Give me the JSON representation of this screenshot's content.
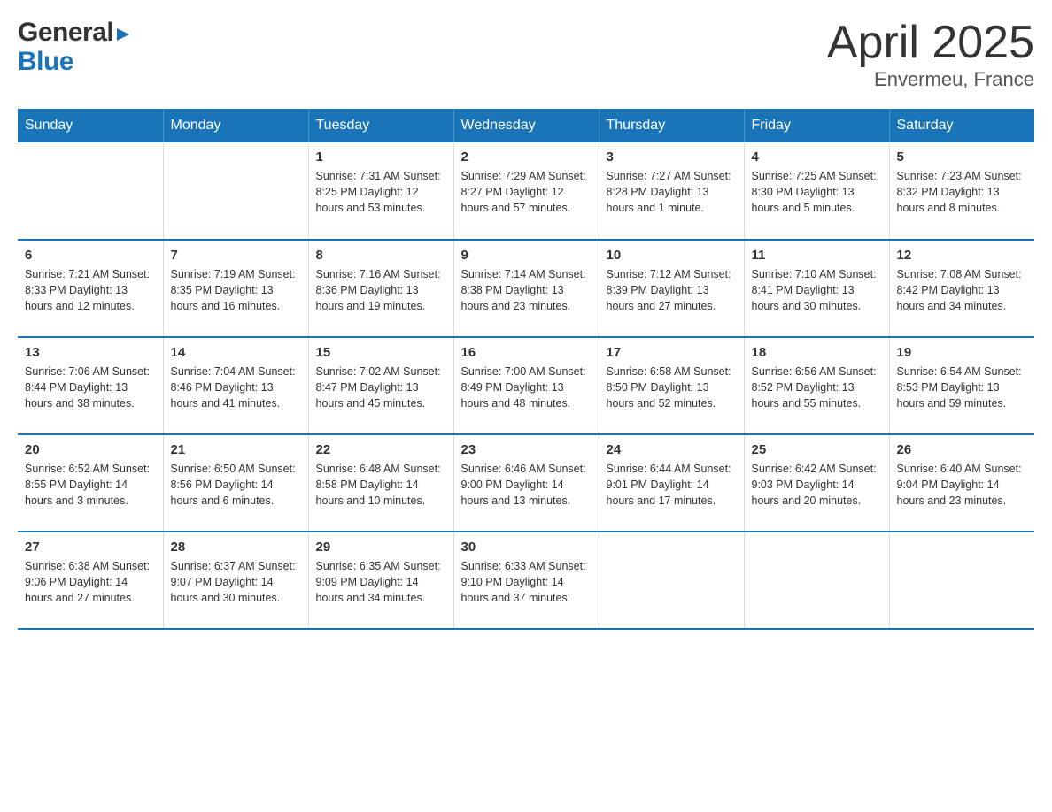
{
  "header": {
    "logo_general": "General",
    "logo_blue": "Blue",
    "title": "April 2025",
    "subtitle": "Envermeu, France"
  },
  "days_of_week": [
    "Sunday",
    "Monday",
    "Tuesday",
    "Wednesday",
    "Thursday",
    "Friday",
    "Saturday"
  ],
  "weeks": [
    [
      {
        "day": "",
        "info": ""
      },
      {
        "day": "",
        "info": ""
      },
      {
        "day": "1",
        "info": "Sunrise: 7:31 AM\nSunset: 8:25 PM\nDaylight: 12 hours\nand 53 minutes."
      },
      {
        "day": "2",
        "info": "Sunrise: 7:29 AM\nSunset: 8:27 PM\nDaylight: 12 hours\nand 57 minutes."
      },
      {
        "day": "3",
        "info": "Sunrise: 7:27 AM\nSunset: 8:28 PM\nDaylight: 13 hours\nand 1 minute."
      },
      {
        "day": "4",
        "info": "Sunrise: 7:25 AM\nSunset: 8:30 PM\nDaylight: 13 hours\nand 5 minutes."
      },
      {
        "day": "5",
        "info": "Sunrise: 7:23 AM\nSunset: 8:32 PM\nDaylight: 13 hours\nand 8 minutes."
      }
    ],
    [
      {
        "day": "6",
        "info": "Sunrise: 7:21 AM\nSunset: 8:33 PM\nDaylight: 13 hours\nand 12 minutes."
      },
      {
        "day": "7",
        "info": "Sunrise: 7:19 AM\nSunset: 8:35 PM\nDaylight: 13 hours\nand 16 minutes."
      },
      {
        "day": "8",
        "info": "Sunrise: 7:16 AM\nSunset: 8:36 PM\nDaylight: 13 hours\nand 19 minutes."
      },
      {
        "day": "9",
        "info": "Sunrise: 7:14 AM\nSunset: 8:38 PM\nDaylight: 13 hours\nand 23 minutes."
      },
      {
        "day": "10",
        "info": "Sunrise: 7:12 AM\nSunset: 8:39 PM\nDaylight: 13 hours\nand 27 minutes."
      },
      {
        "day": "11",
        "info": "Sunrise: 7:10 AM\nSunset: 8:41 PM\nDaylight: 13 hours\nand 30 minutes."
      },
      {
        "day": "12",
        "info": "Sunrise: 7:08 AM\nSunset: 8:42 PM\nDaylight: 13 hours\nand 34 minutes."
      }
    ],
    [
      {
        "day": "13",
        "info": "Sunrise: 7:06 AM\nSunset: 8:44 PM\nDaylight: 13 hours\nand 38 minutes."
      },
      {
        "day": "14",
        "info": "Sunrise: 7:04 AM\nSunset: 8:46 PM\nDaylight: 13 hours\nand 41 minutes."
      },
      {
        "day": "15",
        "info": "Sunrise: 7:02 AM\nSunset: 8:47 PM\nDaylight: 13 hours\nand 45 minutes."
      },
      {
        "day": "16",
        "info": "Sunrise: 7:00 AM\nSunset: 8:49 PM\nDaylight: 13 hours\nand 48 minutes."
      },
      {
        "day": "17",
        "info": "Sunrise: 6:58 AM\nSunset: 8:50 PM\nDaylight: 13 hours\nand 52 minutes."
      },
      {
        "day": "18",
        "info": "Sunrise: 6:56 AM\nSunset: 8:52 PM\nDaylight: 13 hours\nand 55 minutes."
      },
      {
        "day": "19",
        "info": "Sunrise: 6:54 AM\nSunset: 8:53 PM\nDaylight: 13 hours\nand 59 minutes."
      }
    ],
    [
      {
        "day": "20",
        "info": "Sunrise: 6:52 AM\nSunset: 8:55 PM\nDaylight: 14 hours\nand 3 minutes."
      },
      {
        "day": "21",
        "info": "Sunrise: 6:50 AM\nSunset: 8:56 PM\nDaylight: 14 hours\nand 6 minutes."
      },
      {
        "day": "22",
        "info": "Sunrise: 6:48 AM\nSunset: 8:58 PM\nDaylight: 14 hours\nand 10 minutes."
      },
      {
        "day": "23",
        "info": "Sunrise: 6:46 AM\nSunset: 9:00 PM\nDaylight: 14 hours\nand 13 minutes."
      },
      {
        "day": "24",
        "info": "Sunrise: 6:44 AM\nSunset: 9:01 PM\nDaylight: 14 hours\nand 17 minutes."
      },
      {
        "day": "25",
        "info": "Sunrise: 6:42 AM\nSunset: 9:03 PM\nDaylight: 14 hours\nand 20 minutes."
      },
      {
        "day": "26",
        "info": "Sunrise: 6:40 AM\nSunset: 9:04 PM\nDaylight: 14 hours\nand 23 minutes."
      }
    ],
    [
      {
        "day": "27",
        "info": "Sunrise: 6:38 AM\nSunset: 9:06 PM\nDaylight: 14 hours\nand 27 minutes."
      },
      {
        "day": "28",
        "info": "Sunrise: 6:37 AM\nSunset: 9:07 PM\nDaylight: 14 hours\nand 30 minutes."
      },
      {
        "day": "29",
        "info": "Sunrise: 6:35 AM\nSunset: 9:09 PM\nDaylight: 14 hours\nand 34 minutes."
      },
      {
        "day": "30",
        "info": "Sunrise: 6:33 AM\nSunset: 9:10 PM\nDaylight: 14 hours\nand 37 minutes."
      },
      {
        "day": "",
        "info": ""
      },
      {
        "day": "",
        "info": ""
      },
      {
        "day": "",
        "info": ""
      }
    ]
  ]
}
